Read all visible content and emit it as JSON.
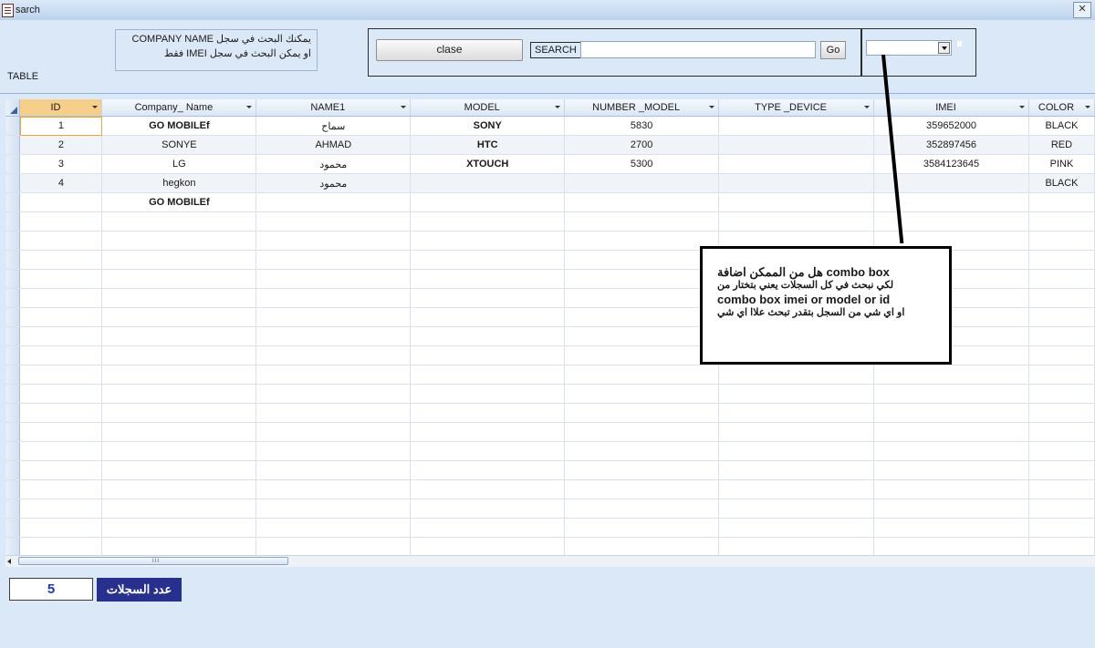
{
  "window": {
    "title": "sarch",
    "close_glyph": "✕"
  },
  "form": {
    "hint_line1": "يمكنك البحث في سجل  COMPANY NAME",
    "hint_line2": "او يمكن البحث في سجل  IMEI   فقط",
    "table_label": "TABLE",
    "close_button": "clase",
    "search_label": "SEARCH",
    "search_value": "",
    "go_button": "Go",
    "combo_value": ""
  },
  "grid": {
    "columns": [
      "ID",
      "Company_ Name",
      "NAME1",
      "MODEL",
      "NUMBER _MODEL",
      "TYPE _DEVICE",
      "IMEI",
      "COLOR"
    ],
    "rows": [
      [
        "1",
        "GO MOBILEf",
        "سماح",
        "SONY",
        "5830",
        "",
        "359652000",
        "BLACK"
      ],
      [
        "2",
        "SONYE",
        "AHMAD",
        "HTC",
        "2700",
        "",
        "352897456",
        "RED"
      ],
      [
        "3",
        "LG",
        "محمود",
        "XTOUCH",
        "5300",
        "",
        "3584123645",
        "PINK"
      ],
      [
        "4",
        "hegkon",
        "محمود",
        "",
        "",
        "",
        "",
        "BLACK"
      ],
      [
        "",
        "GO MOBILEf",
        "",
        "",
        "",
        "",
        "",
        ""
      ]
    ]
  },
  "scroll": {
    "grip": "III"
  },
  "footer": {
    "record_count": "5",
    "record_count_label": "عدد السجلات"
  },
  "callout": {
    "line1": "هل من الممكن اضافة combo box",
    "line2": "لكي نبحث في كل السجلات يعني  بتختار من",
    "line3": "combo box imei or model or id",
    "line4": "او اي شي  من السجل بتقدر تبحث  علاا اي شي"
  }
}
